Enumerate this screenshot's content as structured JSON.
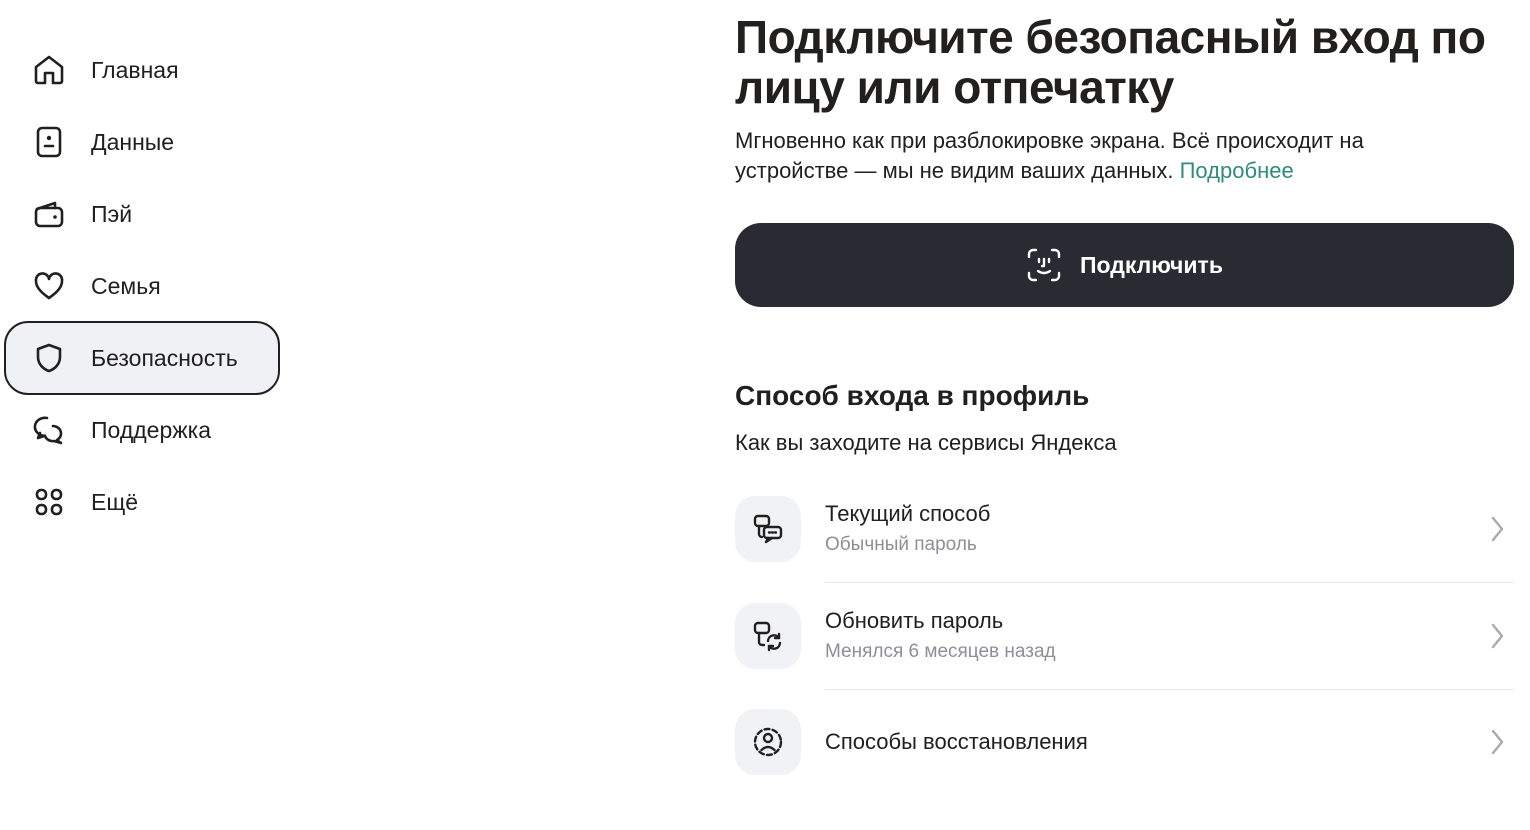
{
  "sidebar": {
    "items": [
      {
        "label": "Главная",
        "icon": "home-icon"
      },
      {
        "label": "Данные",
        "icon": "id-card-icon"
      },
      {
        "label": "Пэй",
        "icon": "wallet-icon"
      },
      {
        "label": "Семья",
        "icon": "heart-icon"
      },
      {
        "label": "Безопасность",
        "icon": "shield-icon",
        "active": true
      },
      {
        "label": "Поддержка",
        "icon": "chat-bubbles-icon"
      },
      {
        "label": "Ещё",
        "icon": "grid-icon"
      }
    ]
  },
  "hero": {
    "title": "Подключите безопасный вход по лицу или отпечатку",
    "subtitle": "Мгновенно как при разблокировке экрана. Всё происходит на устройстве — мы не видим ваших данных.",
    "link": "Подробнее",
    "button_label": "Подключить",
    "button_icon": "face-id-icon"
  },
  "login_method": {
    "title": "Способ входа в профиль",
    "subtitle": "Как вы заходите на сервисы Яндекса",
    "rows": [
      {
        "title": "Текущий способ",
        "desc": "Обычный пароль",
        "icon": "password-key-icon"
      },
      {
        "title": "Обновить пароль",
        "desc": "Менялся 6 месяцев назад",
        "icon": "password-refresh-icon"
      },
      {
        "title": "Способы восстановления",
        "desc": "",
        "icon": "user-recovery-icon"
      }
    ]
  },
  "colors": {
    "text": "#21201f",
    "link": "#2e8c7e",
    "button_bg": "#2a2a32",
    "muted": "#8e8e98",
    "active_bg": "#f0f1f4"
  }
}
